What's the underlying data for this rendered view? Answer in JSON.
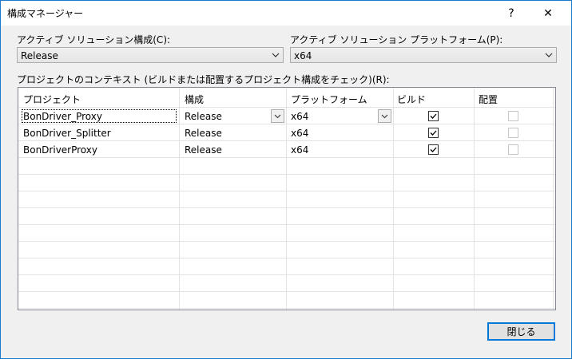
{
  "window": {
    "title": "構成マネージャー",
    "help_label": "?",
    "close_label": "✕"
  },
  "active_config": {
    "label": "アクティブ ソリューション構成(C):",
    "value": "Release"
  },
  "active_platform": {
    "label": "アクティブ ソリューション プラットフォーム(P):",
    "value": "x64"
  },
  "context_label": "プロジェクトのコンテキスト (ビルドまたは配置するプロジェクト構成をチェック)(R):",
  "grid": {
    "columns": [
      "プロジェクト",
      "構成",
      "プラットフォーム",
      "ビルド",
      "配置"
    ],
    "rows": [
      {
        "project": "BonDriver_Proxy",
        "config": "Release",
        "platform": "x64",
        "build": true,
        "deploy": false
      },
      {
        "project": "BonDriver_Splitter",
        "config": "Release",
        "platform": "x64",
        "build": true,
        "deploy": false
      },
      {
        "project": "BonDriverProxy",
        "config": "Release",
        "platform": "x64",
        "build": true,
        "deploy": false
      }
    ]
  },
  "close_button_label": "閉じる"
}
